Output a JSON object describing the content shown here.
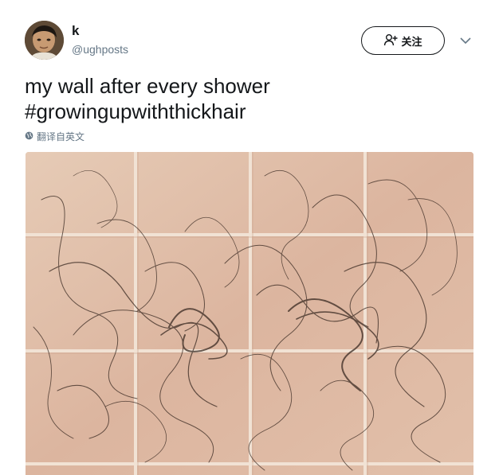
{
  "user": {
    "name": "k",
    "handle": "@ughposts"
  },
  "follow_button": {
    "label": "关注",
    "icon": "add-user-icon"
  },
  "menu": {
    "icon": "chevron-down-icon"
  },
  "tweet": {
    "lines": [
      "my wall after every shower",
      "#growingupwiththickhair"
    ]
  },
  "translate": {
    "label": "翻译自英文",
    "icon": "globe-icon"
  },
  "colors": {
    "text": "#14171a",
    "secondary": "#657786",
    "tile": "#e4c4ae",
    "grout": "#f3e6da"
  }
}
